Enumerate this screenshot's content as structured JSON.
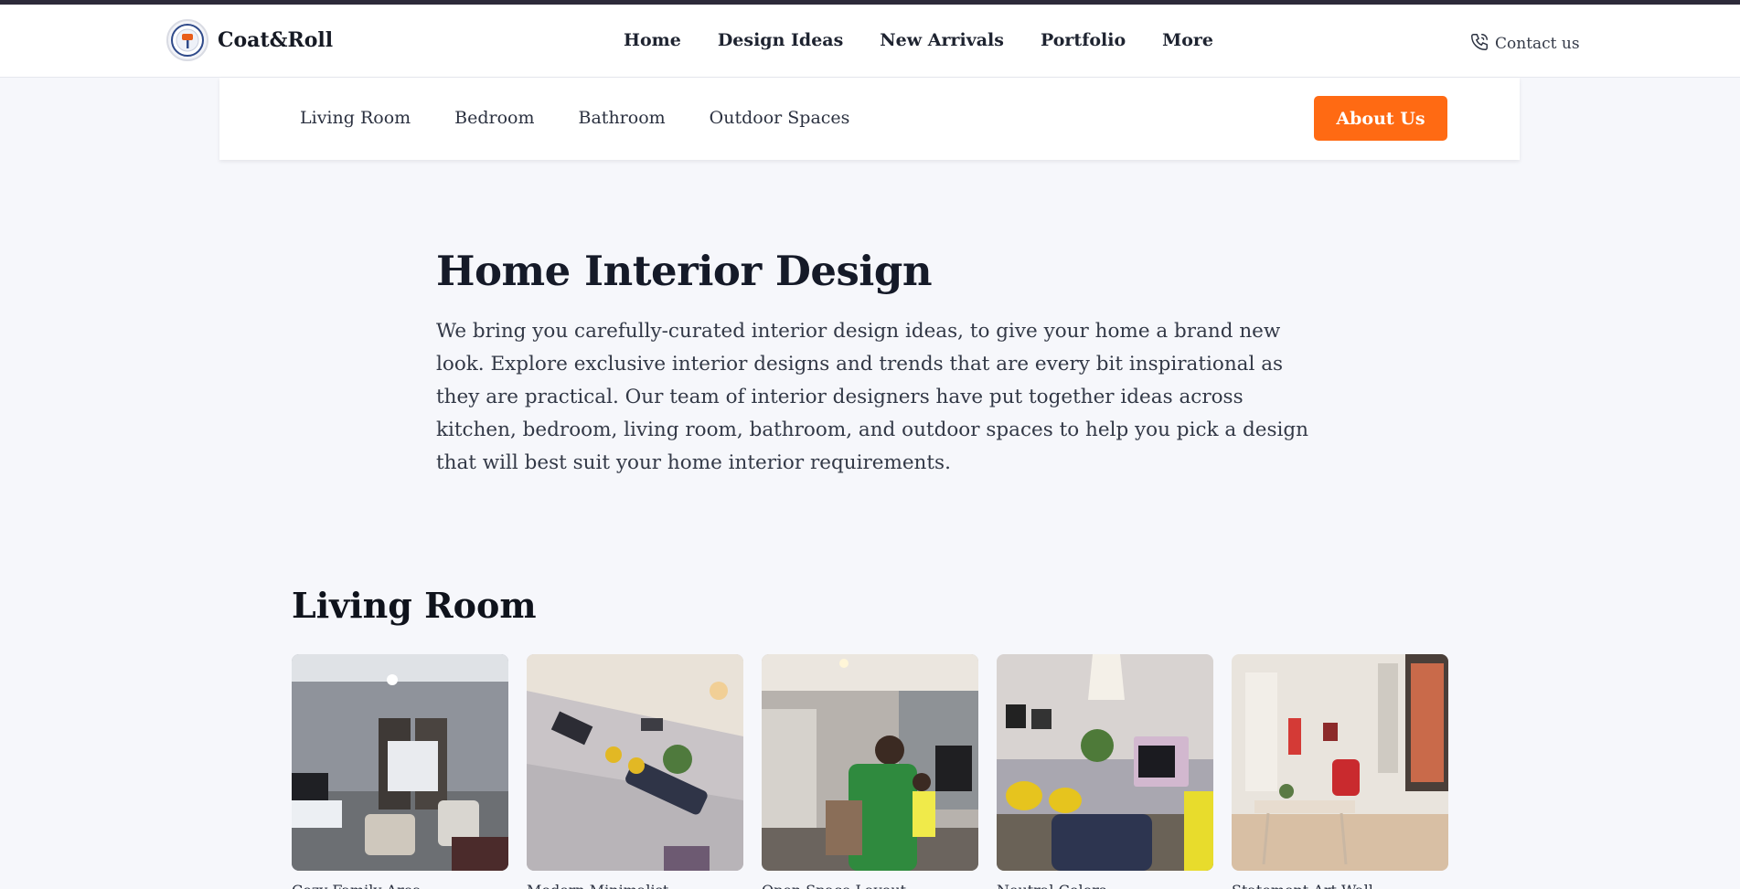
{
  "header": {
    "brand_name": "Coat&Roll",
    "nav": [
      {
        "label": "Home"
      },
      {
        "label": "Design Ideas"
      },
      {
        "label": "New Arrivals"
      },
      {
        "label": "Portfolio"
      },
      {
        "label": "More"
      }
    ],
    "contact_label": "Contact us"
  },
  "subnav": {
    "links": [
      {
        "label": "Living Room"
      },
      {
        "label": "Bedroom"
      },
      {
        "label": "Bathroom"
      },
      {
        "label": "Outdoor Spaces"
      }
    ],
    "about_button": "About Us"
  },
  "intro": {
    "title": "Home Interior Design",
    "body": "We bring you carefully-curated interior design ideas, to give your home a brand new look. Explore exclusive interior designs and trends that are every bit inspirational as they are practical. Our team of interior designers have put together ideas across kitchen, bedroom, living room, bathroom, and outdoor spaces to help you pick a design that will best suit your home interior requirements."
  },
  "living_room": {
    "title": "Living Room",
    "cards": [
      {
        "caption": "Cozy Family Area"
      },
      {
        "caption": "Modern Minimalist"
      },
      {
        "caption": "Open Space Layout"
      },
      {
        "caption": "Neutral Colors"
      },
      {
        "caption": "Statement Art Wall"
      }
    ]
  },
  "colors": {
    "accent": "#ff6a13",
    "background": "#f6f7fb",
    "top_line": "#2d2a3a"
  },
  "icons": {
    "logo": "brand-logo-badge",
    "contact": "phone-icon"
  }
}
